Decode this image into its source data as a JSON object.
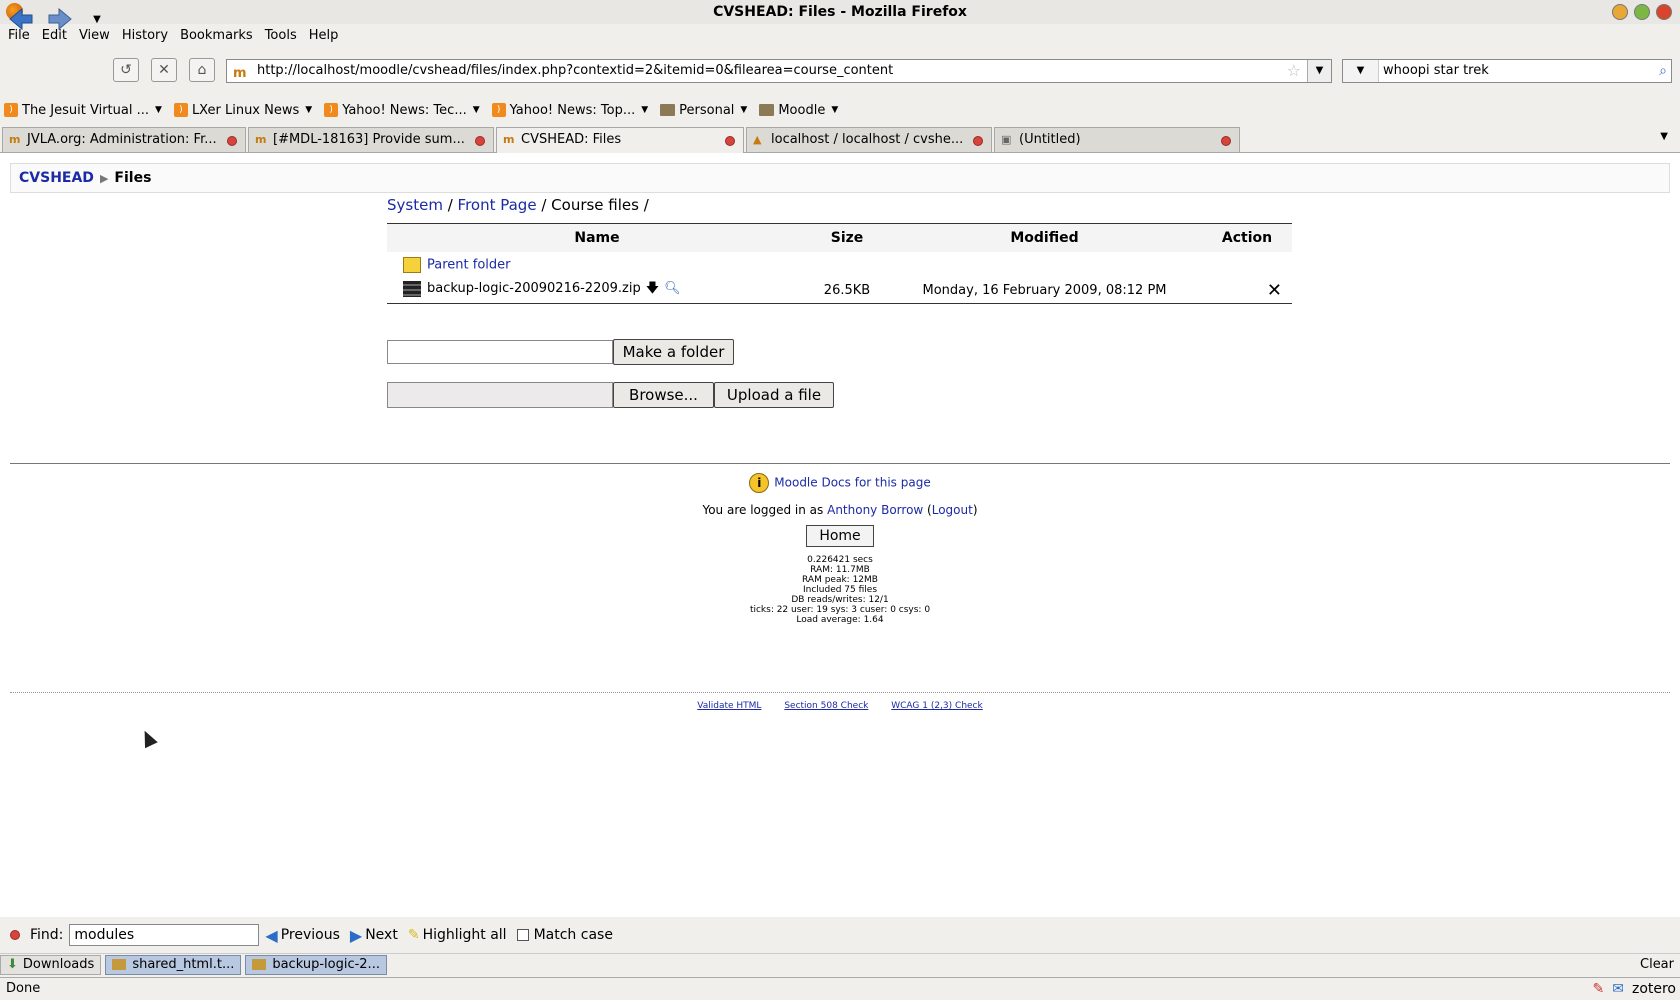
{
  "window": {
    "title": "CVSHEAD: Files - Mozilla Firefox"
  },
  "menu": [
    "File",
    "Edit",
    "View",
    "History",
    "Bookmarks",
    "Tools",
    "Help"
  ],
  "nav": {
    "url": "http://localhost/moodle/cvshead/files/index.php?contextid=2&itemid=0&filearea=course_content",
    "search": "whoopi star trek"
  },
  "bookmarks": [
    {
      "label": "The Jesuit Virtual ...",
      "icon": "rss"
    },
    {
      "label": "LXer Linux News",
      "icon": "rss"
    },
    {
      "label": "Yahoo! News: Tec...",
      "icon": "rss"
    },
    {
      "label": "Yahoo! News: Top...",
      "icon": "rss"
    },
    {
      "label": "Personal",
      "icon": "folder"
    },
    {
      "label": "Moodle",
      "icon": "folder"
    }
  ],
  "tabs": [
    {
      "label": "JVLA.org: Administration: Fr..."
    },
    {
      "label": "[#MDL-18163] Provide sum..."
    },
    {
      "label": "CVSHEAD: Files"
    },
    {
      "label": "localhost / localhost / cvshe..."
    },
    {
      "label": "(Untitled)"
    }
  ],
  "breadcrumb": {
    "root": "CVSHEAD",
    "current": "Files"
  },
  "path": {
    "system": "System",
    "front": "Front Page",
    "rest": "/ Course files /"
  },
  "table": {
    "headers": {
      "name": "Name",
      "size": "Size",
      "modified": "Modified",
      "action": "Action"
    },
    "parent": "Parent folder",
    "file": {
      "name": "backup-logic-20090216-2209.zip",
      "size": "26.5KB",
      "modified": "Monday, 16 February 2009, 08:12 PM"
    }
  },
  "forms": {
    "make_folder": "Make a folder",
    "browse": "Browse...",
    "upload": "Upload a file"
  },
  "footer": {
    "docs": "Moodle Docs for this page",
    "logged_in_prefix": "You are logged in as",
    "user": "Anthony Borrow",
    "logout": "Logout",
    "home": "Home",
    "perf": [
      "0.226421 secs",
      "RAM: 11.7MB",
      "RAM peak: 12MB",
      "Included 75 files",
      "DB reads/writes: 12/1",
      "ticks: 22 user: 19 sys: 3 cuser: 0 csys: 0",
      "Load average: 1.64"
    ],
    "validators": [
      "Validate HTML",
      "Section 508 Check",
      "WCAG 1 (2,3) Check"
    ]
  },
  "findbar": {
    "label": "Find:",
    "value": "modules",
    "previous": "Previous",
    "next": "Next",
    "highlight": "Highlight all",
    "match": "Match case"
  },
  "downloads": {
    "label": "Downloads",
    "items": [
      "shared_html.t...",
      "backup-logic-2..."
    ],
    "clear": "Clear"
  },
  "status": {
    "text": "Done",
    "zotero": "zotero"
  }
}
